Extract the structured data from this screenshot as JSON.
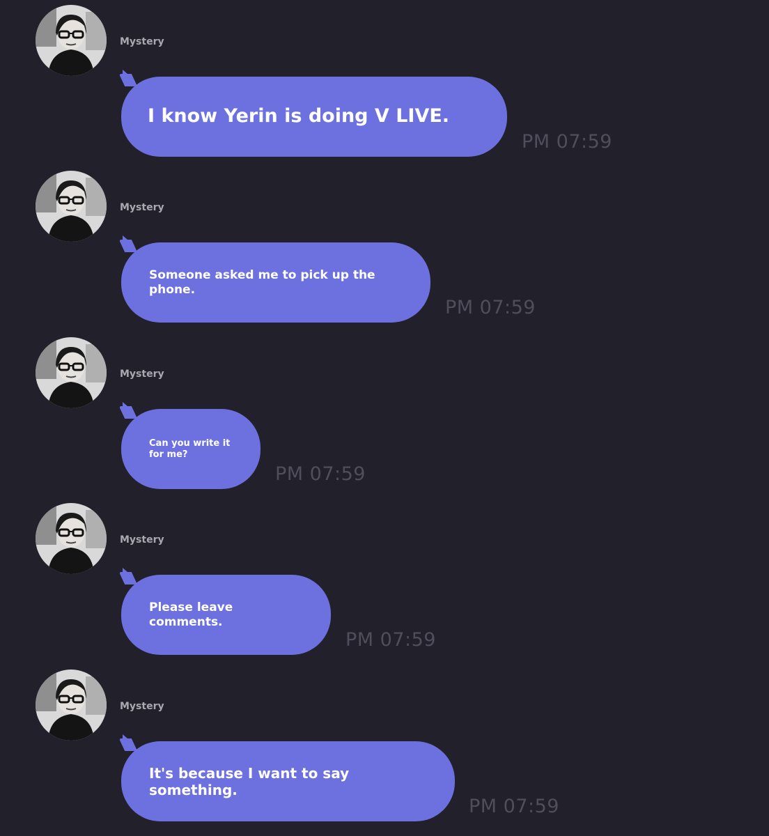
{
  "messages": [
    {
      "sender": "Mystery",
      "text": "I know Yerin is doing V LIVE.",
      "time": "PM 07:59"
    },
    {
      "sender": "Mystery",
      "text": "Someone asked me to pick up the phone.",
      "time": "PM 07:59"
    },
    {
      "sender": "Mystery",
      "text": "Can you write it\n for me?",
      "time": "PM 07:59"
    },
    {
      "sender": "Mystery",
      "text": "Please leave comments.",
      "time": "PM 07:59"
    },
    {
      "sender": "Mystery",
      "text": "It's because I want to say something.",
      "time": "PM 07:59"
    }
  ],
  "colors": {
    "background": "#22212b",
    "bubble": "#6c71df",
    "bubble_text": "#ffffff",
    "sender_text": "#a9a8b0",
    "time_text": "#4f4e5a"
  },
  "icons": {
    "avatar": "avatar-image"
  }
}
